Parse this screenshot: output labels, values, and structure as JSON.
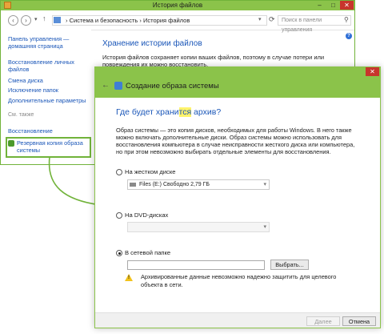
{
  "file_history_window": {
    "title": "История файлов",
    "window_controls": {
      "minimize": "–",
      "maximize": "□",
      "close": "✕"
    },
    "breadcrumb": {
      "sep": "›",
      "level1": "Система и безопасность",
      "level2": "История файлов"
    },
    "search_placeholder": "Поиск в панели управления",
    "sidebar": {
      "home_link": "Панель управления — домашняя страница",
      "items": [
        "Восстановление личных файлов",
        "Смена диска",
        "Исключение папок",
        "Дополнительные параметры"
      ],
      "see_also": "См. также",
      "see_also_items": [
        "Восстановление",
        "Резервная копия образа системы"
      ]
    },
    "content_title": "Хранение истории файлов",
    "content_desc": "История файлов сохраняет копии ваших файлов, поэтому в случае потери или повреждения их можно восстановить."
  },
  "system_image_dialog": {
    "title": "Создание образа системы",
    "question": {
      "before": "Где будет храни",
      "highlight": "тся",
      "after": " архив?"
    },
    "description": "Образ системы — это копия дисков, необходимых для работы Windows. В него также можно включать дополнительные диски. Образ системы можно использовать для восстановления компьютера в случае неисправности жесткого диска или компьютера, но при этом невозможно выбирать отдельные элементы для восстановления.",
    "option_hdd": "На жестком диске",
    "hdd_value": "Files (E:)  Свободно 2,79 ГБ",
    "option_dvd": "На DVD-дисках",
    "dvd_value": "",
    "option_network": "В сетевой папке",
    "network_path": "",
    "browse_label": "Выбрать...",
    "warning": "Архивированные данные невозможно надежно защитить для целевого объекта в сети.",
    "next_label": "Далее",
    "cancel_label": "Отмена",
    "close_glyph": "✕",
    "selected_option": "network"
  },
  "colors": {
    "accent_green": "#8bc34a",
    "link_blue": "#1a56b8",
    "highlight_yellow": "#fff36b",
    "close_red": "#c8352c"
  }
}
